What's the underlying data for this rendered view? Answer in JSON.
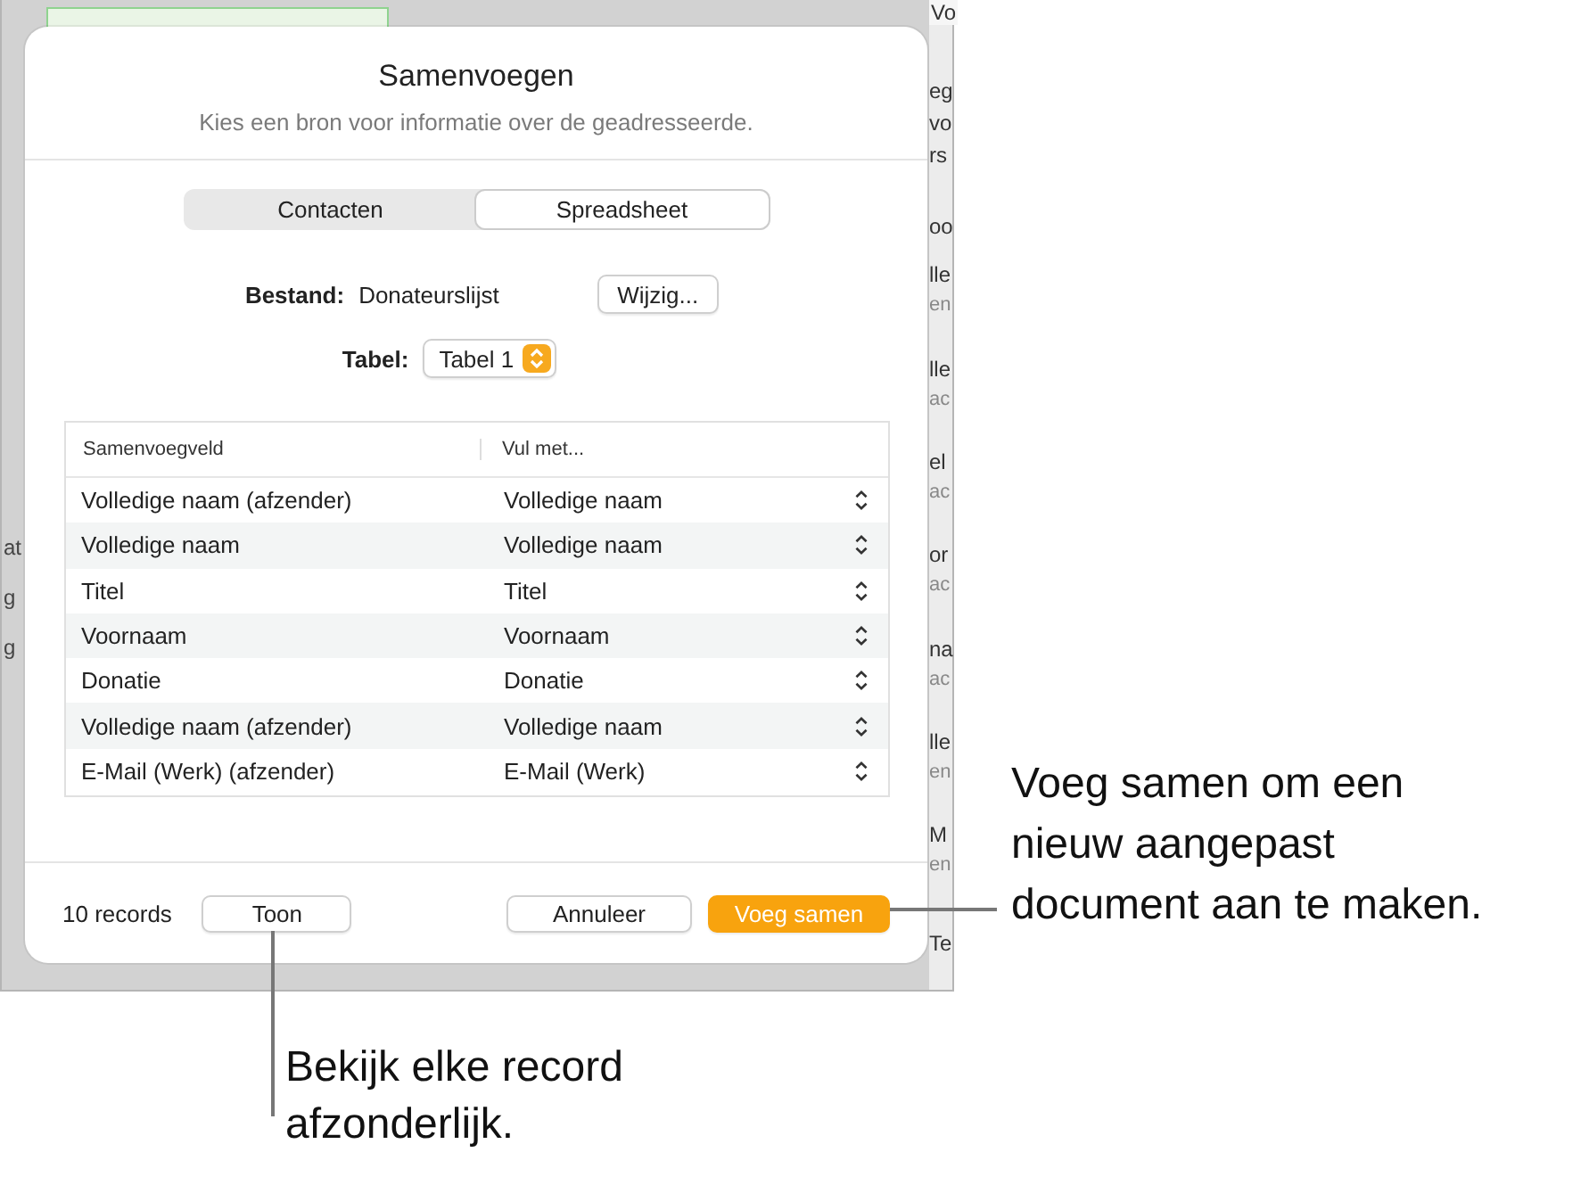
{
  "background": {
    "right_top": "Vo",
    "right_header": [
      "eg",
      "vo",
      "rs"
    ],
    "right_label": "oo",
    "right_items": [
      {
        "main": "lle",
        "sub": "en"
      },
      {
        "main": "lle",
        "sub": "ac"
      },
      {
        "main": "el",
        "sub": "ac"
      },
      {
        "main": "or",
        "sub": "ac"
      },
      {
        "main": "na",
        "sub": "ac"
      },
      {
        "main": "lle",
        "sub": "en"
      },
      {
        "main": "M",
        "sub": "en"
      },
      {
        "main": "Te"
      }
    ],
    "left_fragments": [
      "at",
      "g",
      "g"
    ]
  },
  "dialog": {
    "title": "Samenvoegen",
    "subtitle": "Kies een bron voor informatie over de geadresseerde.",
    "source_tabs": [
      {
        "label": "Contacten",
        "selected": false
      },
      {
        "label": "Spreadsheet",
        "selected": true
      }
    ],
    "file": {
      "label": "Bestand:",
      "value": "Donateurslijst",
      "button": "Wijzig..."
    },
    "table_select": {
      "label": "Tabel:",
      "value": "Tabel 1"
    },
    "table": {
      "columns": [
        "Samenvoegveld",
        "Vul met..."
      ],
      "rows": [
        {
          "field": "Volledige naam (afzender)",
          "fill": "Volledige naam"
        },
        {
          "field": "Volledige naam",
          "fill": "Volledige naam"
        },
        {
          "field": "Titel",
          "fill": "Titel"
        },
        {
          "field": "Voornaam",
          "fill": "Voornaam"
        },
        {
          "field": "Donatie",
          "fill": "Donatie"
        },
        {
          "field": "Volledige naam (afzender)",
          "fill": "Volledige naam"
        },
        {
          "field": "E-Mail (Werk) (afzender)",
          "fill": "E-Mail (Werk)"
        }
      ]
    },
    "record_count": "10 records",
    "show_button": "Toon",
    "cancel_button": "Annuleer",
    "merge_button": "Voeg samen"
  },
  "callouts": [
    {
      "kind": "right",
      "lines": [
        "Voeg samen om een",
        "nieuw aangepast",
        "document aan te maken."
      ]
    },
    {
      "kind": "below",
      "lines": [
        "Bekijk elke record",
        "afzonderlijk."
      ]
    }
  ]
}
